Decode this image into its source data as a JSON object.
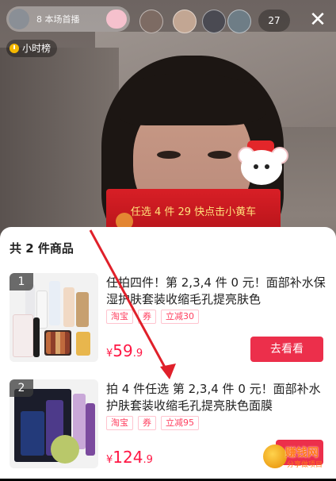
{
  "topbar": {
    "host_subtitle": "8 本场首播",
    "viewer_count": "27",
    "close_glyph": "✕"
  },
  "rank": {
    "label": "小时榜"
  },
  "banner": {
    "text": "任选 4 件 29 快点击小黄车"
  },
  "sheet": {
    "title": "共 2 件商品",
    "items": [
      {
        "index": "1",
        "title": "任拍四件！第 2,3,4 件 0 元！面部补水保湿护肤套装收缩毛孔提亮肤色",
        "tags": [
          "淘宝",
          "券",
          "立减30"
        ],
        "price_symbol": "¥",
        "price_main": "59",
        "price_decimal": ".9",
        "button": "去看看"
      },
      {
        "index": "2",
        "title": "拍 4 件任选 第 2,3,4 件 0 元！面部补水护肤套装收缩毛孔提亮肤色面膜",
        "tags": [
          "淘宝",
          "券",
          "立减95"
        ],
        "price_symbol": "¥",
        "price_main": "124",
        "price_decimal": ".9",
        "button": "去看看"
      }
    ]
  },
  "watermark": {
    "main": "赚钱网",
    "sub": "分享做项目"
  },
  "colors": {
    "accent": "#ec2f4b",
    "price": "#ff1744",
    "banner": "#d81f26",
    "arrow": "#e0202a"
  }
}
